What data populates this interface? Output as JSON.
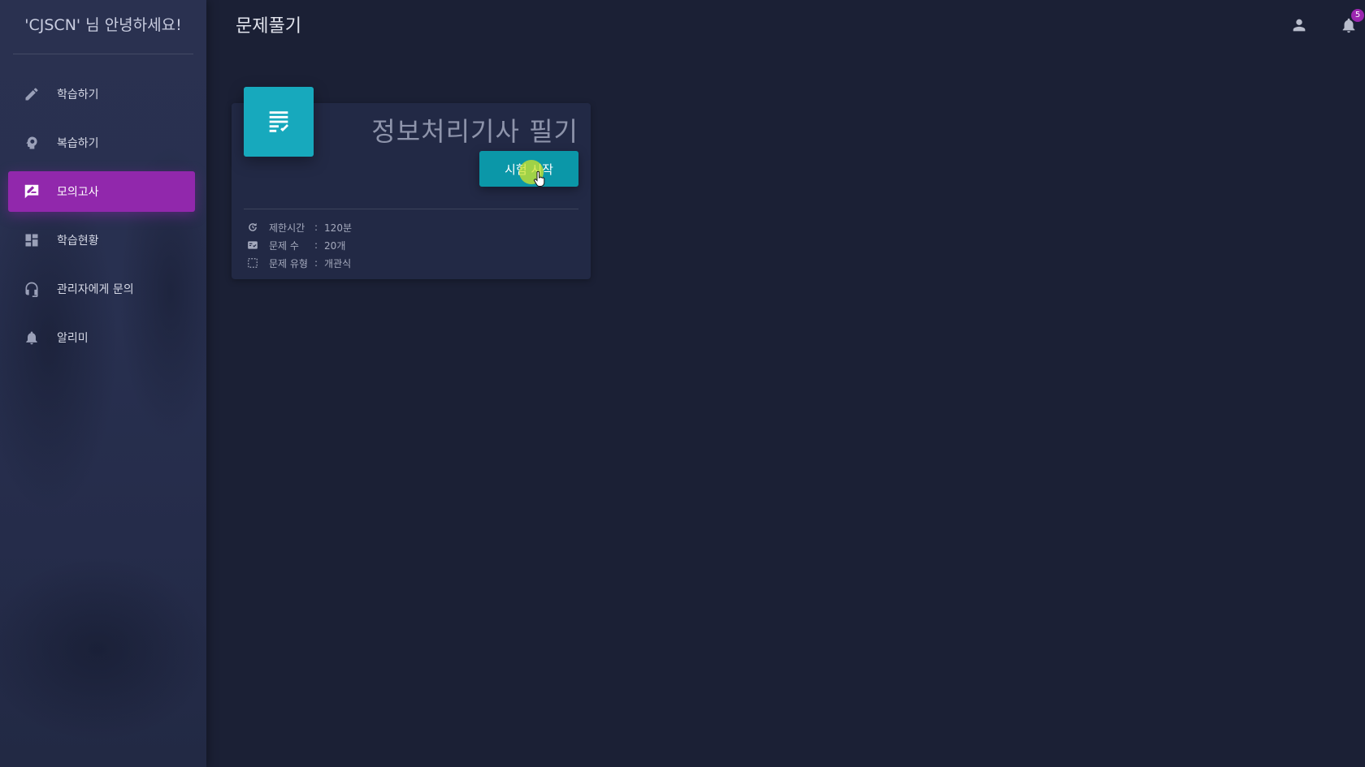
{
  "sidebar": {
    "greeting": "'CJSCN' 님 안녕하세요!",
    "items": [
      {
        "label": "학습하기",
        "icon": "pencil-icon",
        "active": false
      },
      {
        "label": "복습하기",
        "icon": "head-gear-icon",
        "active": false
      },
      {
        "label": "모의고사",
        "icon": "chat-edit-icon",
        "active": true
      },
      {
        "label": "학습현황",
        "icon": "dashboard-icon",
        "active": false
      },
      {
        "label": "관리자에게 문의",
        "icon": "headset-icon",
        "active": false
      },
      {
        "label": "알리미",
        "icon": "bell-icon",
        "active": false
      }
    ]
  },
  "header": {
    "title": "문제풀기",
    "notification_count": "5"
  },
  "card": {
    "icon": "document-check-icon",
    "title": "정보처리기사 필기",
    "start_button": "시험 시작",
    "info": [
      {
        "icon": "timer-icon",
        "label": "제한시간",
        "value": "120분"
      },
      {
        "icon": "checklist-icon",
        "label": "문제 수",
        "value": "20개"
      },
      {
        "icon": "select-box-icon",
        "label": "문제 유형",
        "value": "개관식"
      }
    ]
  },
  "colors": {
    "background": "#1b2035",
    "sidebar": "#283050",
    "active_item": "#9128ac",
    "card_icon": "#17a9bd",
    "start_button": "#0b97a8",
    "badge": "#9c27b0"
  }
}
